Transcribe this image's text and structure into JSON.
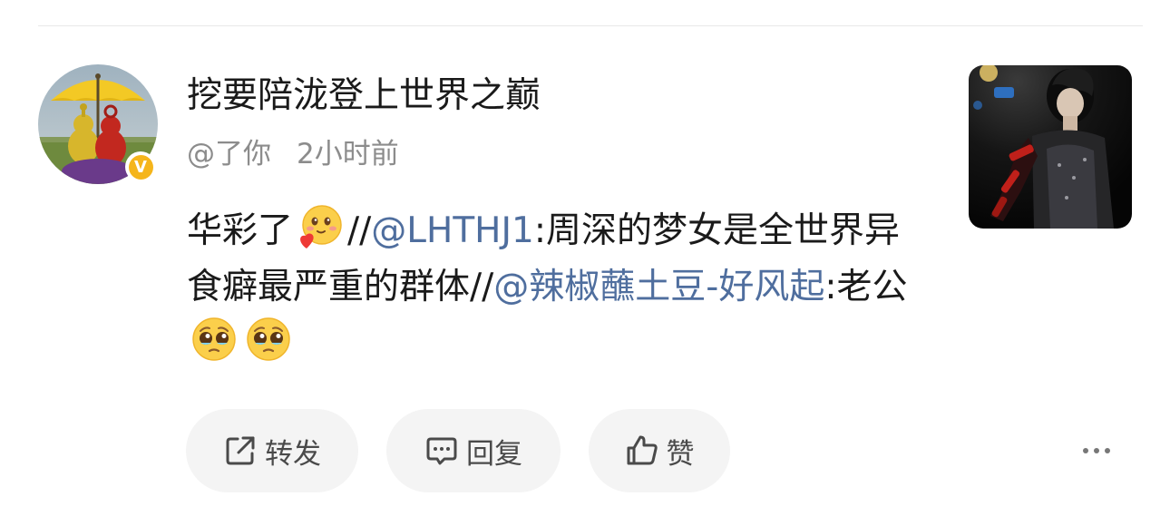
{
  "comment": {
    "author": {
      "name": "挖要陪泷登上世界之巅",
      "verified_badge": "V",
      "avatar_icon": "yellow-umbrella-teletubbies-avatar"
    },
    "meta": {
      "reply_to": "@了你",
      "time": "2小时前"
    },
    "content": {
      "part1": "华彩了",
      "emoji1": "blushing-heart-emoji",
      "sep1": "//",
      "mention1": "@LHTHJ1",
      "part2": ":周深的梦女是全世界异食癖最严重的群体",
      "sep2": "//",
      "mention2": "@辣椒蘸土豆-好风起",
      "part3": ":老公",
      "emoji2": "pleading-face-emoji",
      "emoji3": "pleading-face-emoji"
    },
    "thumbnail_icon": "performer-photo-thumbnail"
  },
  "actions": {
    "repost_label": "转发",
    "reply_label": "回复",
    "like_label": "赞",
    "repost_icon": "share-external-icon",
    "reply_icon": "comment-bubble-icon",
    "like_icon": "thumbs-up-icon",
    "more_icon": "more-dots-icon"
  },
  "colors": {
    "mention": "#4f6e9e",
    "meta_text": "#8c8c8c",
    "button_bg": "#f4f4f4",
    "verified_badge": "#f5b51b"
  }
}
